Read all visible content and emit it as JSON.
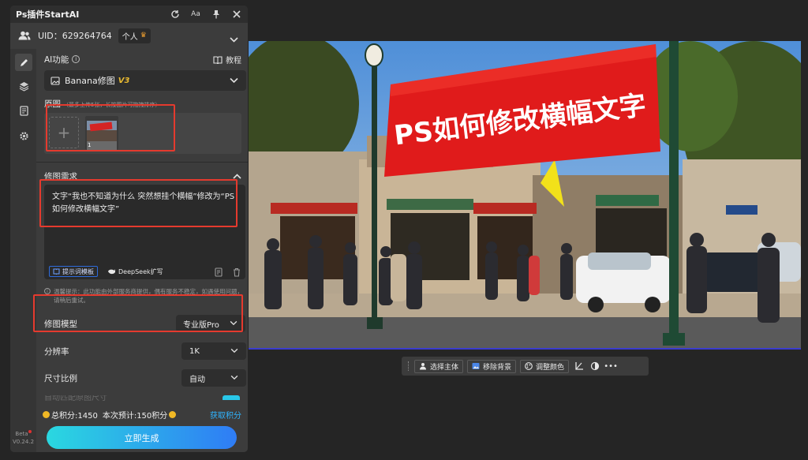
{
  "window": {
    "title": "Ps插件StartAI",
    "icons": [
      "refresh-icon",
      "font-size-icon",
      "pin-icon",
      "close-icon"
    ],
    "font_icon_label": "Aa"
  },
  "user": {
    "uid_label": "UID：629264764",
    "plan_label": "个人",
    "crown": "♛"
  },
  "sidebar": {
    "items": [
      {
        "icon": "brush-icon",
        "active": true
      },
      {
        "icon": "layers-icon",
        "active": false
      },
      {
        "icon": "document-icon",
        "active": false
      },
      {
        "icon": "gear-icon",
        "active": false
      }
    ],
    "beta_label": "Beta",
    "version": "V0.24.2"
  },
  "ai_function": {
    "label": "AI功能",
    "info": "i",
    "tutorial_label": "教程",
    "selected": "Banana修图",
    "badge": "V3"
  },
  "original": {
    "label": "原图",
    "hint": "（最多上传5张，长按图片可拖拽排序）",
    "add_label": "+",
    "thumb_index": "1"
  },
  "requirement": {
    "label": "修图需求",
    "text": "文字“我也不知道为什么 突然想挂个横幅”修改为“PS如何修改横幅文字”",
    "template_label": "提示词模板",
    "deepseek_label": "DeepSeek扩写"
  },
  "notice": {
    "icon": "i",
    "text": "温馨提示：此功能由外部服务商提供，偶有服务不稳定，如遇使用问题，请稍后重试。"
  },
  "model": {
    "label": "修图模型",
    "value": "专业版Pro"
  },
  "resolution": {
    "label": "分辨率",
    "value": "1K"
  },
  "aspect": {
    "label": "尺寸比例",
    "value": "自动"
  },
  "hidden_row_label": "自动匹配原图尺寸",
  "footer": {
    "total_points": "总积分:1450",
    "estimate": "本次预计:150积分",
    "get_points": "获取积分",
    "generate": "立即生成"
  },
  "canvas": {
    "banner_text": "PS如何修改横幅文字"
  },
  "floatbar": {
    "select_subject": "选择主体",
    "remove_bg": "移除背景",
    "adjust_color": "调整颜色",
    "more": "•••"
  },
  "colors": {
    "panel": "#3c3c3c",
    "accent_blue": "#2fb4ff",
    "gradient_start": "#2ad8e0",
    "gradient_end": "#2f7cf5",
    "highlight_red": "#e53a2e",
    "banner_red": "#e01b1b"
  }
}
